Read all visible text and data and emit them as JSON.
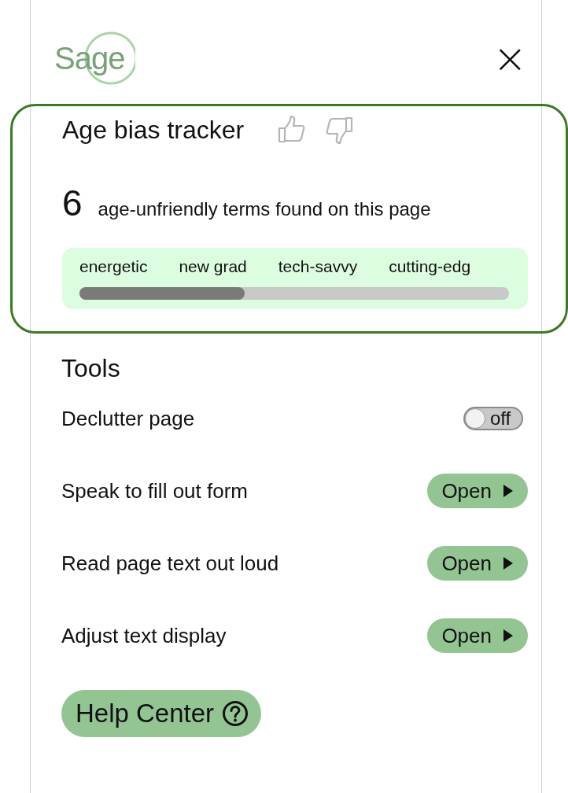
{
  "header": {
    "logo": "Sage",
    "close": "×"
  },
  "tracker": {
    "title": "Age bias tracker",
    "count": "6",
    "caption": "age-unfriendly terms found on this page",
    "terms": [
      "energetic",
      "new grad",
      "tech-savvy",
      "cutting-edg"
    ],
    "scroll": {
      "level": 0.385
    }
  },
  "tools": {
    "title": "Tools",
    "items": [
      {
        "kind": "toggle",
        "label": "Declutter page",
        "on": false,
        "state_label": "off"
      },
      {
        "kind": "open",
        "label": "Speak to fill out form",
        "button": "Open"
      },
      {
        "kind": "open",
        "label": "Read page text out loud",
        "button": "Open"
      },
      {
        "kind": "open",
        "label": "Adjust text display",
        "button": "Open"
      }
    ]
  },
  "help": {
    "label": "Help Center"
  }
}
